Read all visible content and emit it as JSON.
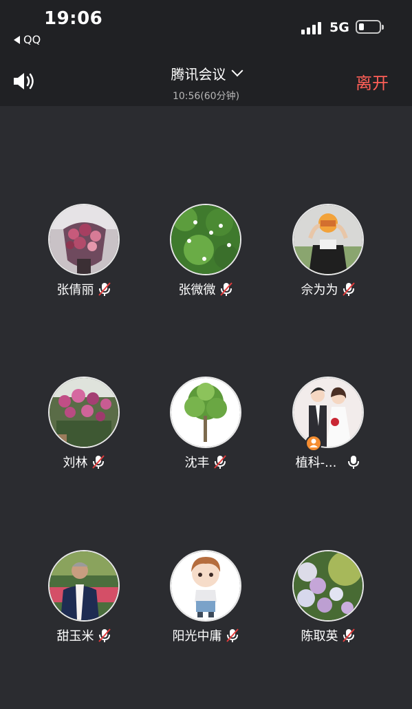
{
  "status_bar": {
    "time": "19:06",
    "back_app": "QQ",
    "network": "5G"
  },
  "meeting": {
    "title": "腾讯会议",
    "subtitle": "10:56(60分钟)",
    "leave_label": "离开",
    "leave_color": "#ff5f57"
  },
  "participants": [
    {
      "name": "张倩丽",
      "mic": "muted"
    },
    {
      "name": "张微微",
      "mic": "muted"
    },
    {
      "name": "佘为为",
      "mic": "muted"
    },
    {
      "name": "刘林",
      "mic": "muted"
    },
    {
      "name": "沈丰",
      "mic": "muted"
    },
    {
      "name": "植科-...",
      "mic": "on",
      "host": true
    },
    {
      "name": "甜玉米",
      "mic": "muted"
    },
    {
      "name": "阳光中庸",
      "mic": "muted"
    },
    {
      "name": "陈取英",
      "mic": "muted"
    }
  ],
  "icons": {
    "speaker": "speaker-icon",
    "mic_muted": "mic-muted-icon",
    "mic_on": "mic-icon",
    "host": "host-icon",
    "dropdown": "chevron-down-icon"
  }
}
